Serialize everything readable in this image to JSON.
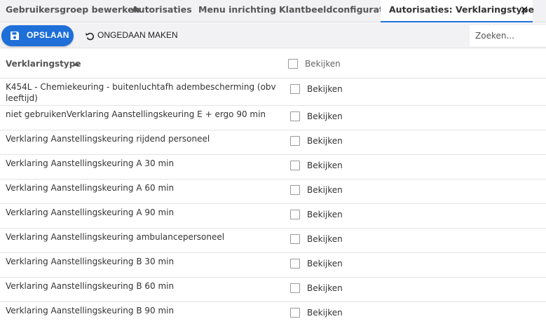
{
  "tabs": [
    {
      "label": "Gebruikersgroep bewerken",
      "active": false
    },
    {
      "label": "Autorisaties",
      "active": false
    },
    {
      "label": "Menu inrichting",
      "active": false
    },
    {
      "label": "Klantbeeldconfiguratie",
      "active": false
    },
    {
      "label": "Autorisaties: Verklaringstype",
      "active": true
    }
  ],
  "toolbar": {
    "save_label": "OPSLAAN",
    "undo_label": "ONGEDAAN MAKEN",
    "search_placeholder": "Zoeken..."
  },
  "colors": {
    "accent": "#1e6fd8",
    "tabbar_bg": "#f2f2f4"
  },
  "grid": {
    "column_title": "Verklaringstype",
    "check_column_label": "Bekijken",
    "rows": [
      {
        "name": "K454L - Chemiekeuring - buitenluchtafh adembescherming (obv leeftijd)",
        "check_label": "Bekijken",
        "checked": false
      },
      {
        "name": "niet gebruikenVerklaring Aanstellingskeuring E + ergo 90 min",
        "check_label": "Bekijken",
        "checked": false
      },
      {
        "name": "Verklaring Aanstellingskeuring rijdend personeel",
        "check_label": "Bekijken",
        "checked": false
      },
      {
        "name": "Verklaring Aanstellingskeuring A 30 min",
        "check_label": "Bekijken",
        "checked": false
      },
      {
        "name": "Verklaring Aanstellingskeuring A 60 min",
        "check_label": "Bekijken",
        "checked": false
      },
      {
        "name": "Verklaring Aanstellingskeuring A 90 min",
        "check_label": "Bekijken",
        "checked": false
      },
      {
        "name": "Verklaring Aanstellingskeuring ambulancepersoneel",
        "check_label": "Bekijken",
        "checked": false
      },
      {
        "name": "Verklaring Aanstellingskeuring B 30 min",
        "check_label": "Bekijken",
        "checked": false
      },
      {
        "name": "Verklaring Aanstellingskeuring B 60 min",
        "check_label": "Bekijken",
        "checked": false
      },
      {
        "name": "Verklaring Aanstellingskeuring B 90 min",
        "check_label": "Bekijken",
        "checked": false
      }
    ]
  }
}
